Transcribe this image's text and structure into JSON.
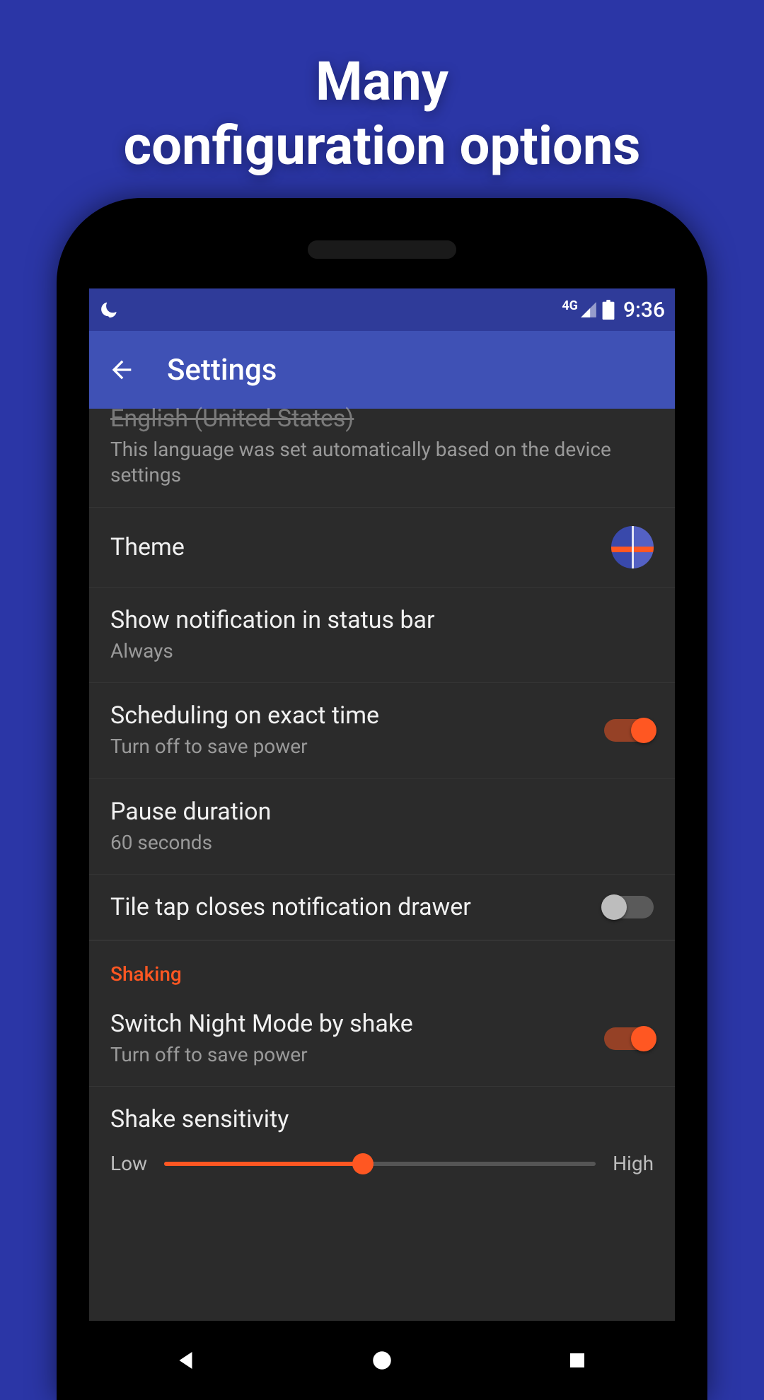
{
  "promo": {
    "line1": "Many",
    "line2": "configuration options"
  },
  "statusbar": {
    "network_label": "4G",
    "time": "9:36"
  },
  "appbar": {
    "title": "Settings"
  },
  "language_row": {
    "title_truncated": "English (United States)",
    "description": "This language was set automatically based on the device settings"
  },
  "theme_row": {
    "title": "Theme"
  },
  "notification_row": {
    "title": "Show notification in status bar",
    "value": "Always"
  },
  "scheduling_row": {
    "title": "Scheduling on exact time",
    "sub": "Turn off to save power",
    "on": true
  },
  "pause_row": {
    "title": "Pause duration",
    "value": "60 seconds"
  },
  "tile_row": {
    "title": "Tile tap closes notification drawer",
    "on": false
  },
  "section_shaking": "Shaking",
  "shake_switch_row": {
    "title": "Switch Night Mode by shake",
    "sub": "Turn off to save power",
    "on": true
  },
  "sensitivity_row": {
    "title": "Shake sensitivity",
    "low": "Low",
    "high": "High",
    "percent": 46
  },
  "colors": {
    "accent": "#FF5722",
    "primary": "#3F51B5",
    "primary_dark": "#2F3B99",
    "background": "#2B36A6"
  }
}
